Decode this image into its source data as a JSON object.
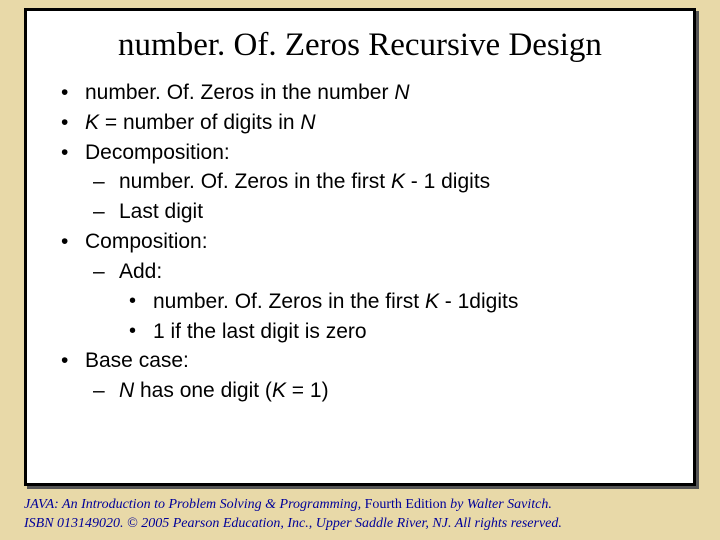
{
  "slide": {
    "title": "number. Of. Zeros Recursive Design",
    "bullets": {
      "b1_pre": "number. Of. Zeros in the number ",
      "b1_ital": "N",
      "b2_ital1": "K",
      "b2_mid": " = number of digits in ",
      "b2_ital2": "N",
      "b3": "Decomposition:",
      "b3a_pre": "number. Of. Zeros in the first ",
      "b3a_ital": "K",
      "b3a_post": " - 1 digits",
      "b3b": "Last digit",
      "b4": "Composition:",
      "b4a": "Add:",
      "b4a1_pre": "number. Of. Zeros in the first ",
      "b4a1_ital": "K",
      "b4a1_post": " - 1digits",
      "b4a2": "1 if the last digit is zero",
      "b5": "Base case:",
      "b5a_ital": "N",
      "b5a_mid": " has one digit (",
      "b5a_ital2": "K",
      "b5a_post": " = 1)"
    }
  },
  "footer": {
    "line1_a": "JAVA: An Introduction to Problem Solving & Programming, ",
    "line1_b": "Fourth Edition",
    "line1_c": " by Walter Savitch.",
    "line2": "ISBN 013149020. © 2005 Pearson Education, Inc., Upper Saddle River, NJ. All rights reserved."
  }
}
